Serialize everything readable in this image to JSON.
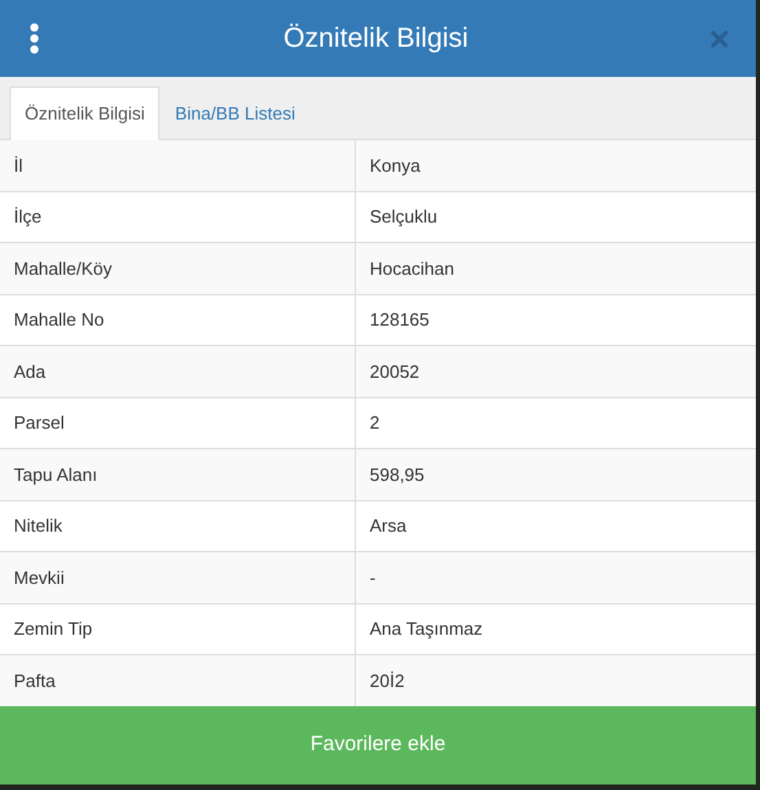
{
  "dialog": {
    "title": "Öznitelik Bilgisi"
  },
  "tabs": [
    {
      "label": "Öznitelik Bilgisi",
      "selected": true
    },
    {
      "label": "Bina/BB Listesi",
      "selected": false
    }
  ],
  "table": {
    "rows": [
      {
        "label": "İl",
        "value": "Konya"
      },
      {
        "label": "İlçe",
        "value": "Selçuklu"
      },
      {
        "label": "Mahalle/Köy",
        "value": "Hocacihan"
      },
      {
        "label": "Mahalle No",
        "value": "128165"
      },
      {
        "label": "Ada",
        "value": "20052"
      },
      {
        "label": "Parsel",
        "value": "2"
      },
      {
        "label": "Tapu Alanı",
        "value": "598,95"
      },
      {
        "label": "Nitelik",
        "value": "Arsa"
      },
      {
        "label": "Mevkii",
        "value": "-"
      },
      {
        "label": "Zemin Tip",
        "value": "Ana Taşınmaz"
      },
      {
        "label": "Pafta",
        "value": "20İ2"
      }
    ]
  },
  "footer_button": "Favorilere ekle"
}
